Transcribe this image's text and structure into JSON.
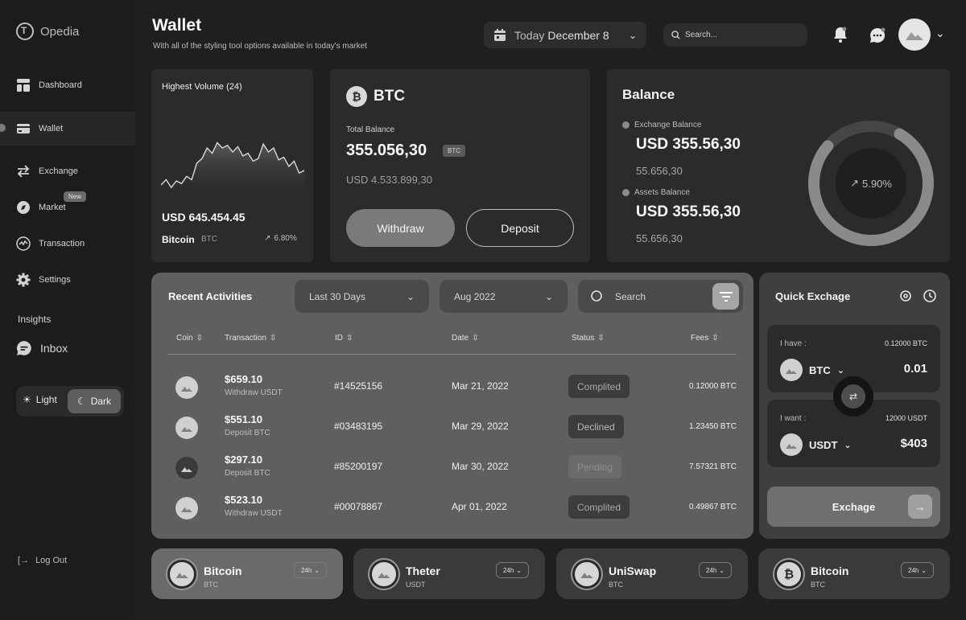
{
  "app": {
    "name": "Opedia"
  },
  "sidebar": {
    "items": [
      {
        "label": "Dashboard",
        "icon": "dashboard-icon"
      },
      {
        "label": "Wallet",
        "icon": "wallet-icon",
        "active": true
      },
      {
        "label": "Exchange",
        "icon": "exchange-icon"
      },
      {
        "label": "Market",
        "icon": "compass-icon",
        "badge": "New"
      },
      {
        "label": "Transaction",
        "icon": "activity-icon"
      },
      {
        "label": "Settings",
        "icon": "gear-icon"
      }
    ],
    "insights_title": "Insights",
    "inbox_label": "Inbox",
    "theme": {
      "light": "Light",
      "dark": "Dark",
      "selected": "Dark"
    },
    "logout": "Log Out"
  },
  "header": {
    "title": "Wallet",
    "subtitle": "With all of the styling tool options available in today's market",
    "date_prefix": "Today",
    "date": "December 8",
    "search_placeholder": "Search..."
  },
  "volume": {
    "title": "Highest Volume (24)",
    "value": "USD 645.454.45",
    "coin": "Bitcoin",
    "ticker": "BTC",
    "change": "6.80%",
    "sparkline": [
      22,
      30,
      18,
      28,
      24,
      35,
      30,
      55,
      62,
      78,
      70,
      86,
      78,
      82,
      72,
      80,
      66,
      70,
      58,
      62,
      84,
      72,
      78,
      60,
      64,
      50,
      58,
      40,
      44
    ]
  },
  "btc": {
    "name": "BTC",
    "total_label": "Total Balance",
    "total_value": "355.056,30",
    "tag": "BTC",
    "usd_value": "USD 4.533.899,30",
    "withdraw": "Withdraw",
    "deposit": "Deposit"
  },
  "balance": {
    "title": "Balance",
    "exchange_label": "Exchange Balance",
    "exchange_value": "USD 355.56,30",
    "exchange_sub": "55.656,30",
    "assets_label": "Assets Balance",
    "assets_value": "USD 355.56,30",
    "assets_sub": "55.656,30",
    "growth": "5.90%",
    "donut_fraction": 0.78
  },
  "activities": {
    "title": "Recent Activities",
    "range": "Last 30 Days",
    "month": "Aug 2022",
    "search_placeholder": "Search",
    "columns": [
      "Coin",
      "Transaction",
      "ID",
      "Date",
      "Status",
      "Fees"
    ],
    "rows": [
      {
        "amount": "$659.10",
        "type": "Withdraw USDT",
        "id": "#14525156",
        "date": "Mar 21, 2022",
        "status": "Complited",
        "status_kind": "complete",
        "fee": "0.12000 BTC"
      },
      {
        "amount": "$551.10",
        "type": "Deposit BTC",
        "id": "#03483195",
        "date": "Mar 29, 2022",
        "status": "Declined",
        "status_kind": "declined",
        "fee": "1.23450 BTC"
      },
      {
        "amount": "$297.10",
        "type": "Deposit BTC",
        "id": "#85200197",
        "date": "Mar 30, 2022",
        "status": "Pending",
        "status_kind": "pending",
        "fee": "7.57321 BTC"
      },
      {
        "amount": "$523.10",
        "type": "Withdraw USDT",
        "id": "#00078867",
        "date": "Apr 01, 2022",
        "status": "Complited",
        "status_kind": "complete",
        "fee": "0.49867 BTC"
      }
    ]
  },
  "quick": {
    "title": "Quick Exchage",
    "have_label": "I have :",
    "have_rate": "0.12000 BTC",
    "have_coin": "BTC",
    "have_amount": "0.01",
    "want_label": "I want :",
    "want_rate": "12000 USDT",
    "want_coin": "USDT",
    "want_amount": "$403",
    "button": "Exchage"
  },
  "coins": [
    {
      "name": "Bitcoin",
      "ticker": "BTC",
      "period": "24h"
    },
    {
      "name": "Theter",
      "ticker": "USDT",
      "period": "24h"
    },
    {
      "name": "UniSwap",
      "ticker": "BTC",
      "period": "24h"
    },
    {
      "name": "Bitcoin",
      "ticker": "BTC",
      "period": "24h"
    }
  ]
}
